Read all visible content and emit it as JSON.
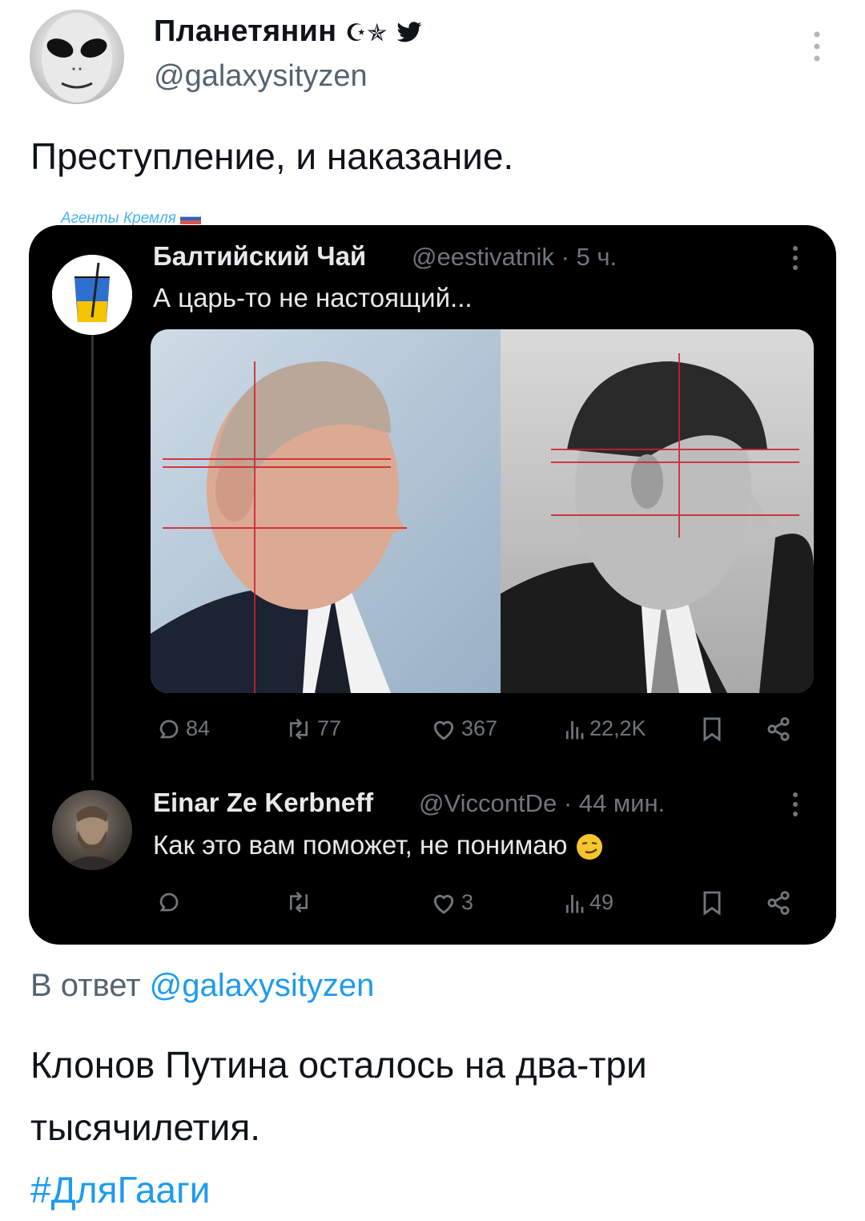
{
  "tweet": {
    "author": {
      "display_name": "Планетянин",
      "name_emoji": "☪︎✯",
      "handle": "@galaxysityzen"
    },
    "text": "Преступление, и наказание."
  },
  "embedded_screenshot": {
    "watermark": "Агенты Кремля",
    "post1": {
      "name": "Балтийский Чай",
      "handle": "@eestivatnik",
      "time": "· 5 ч.",
      "text": "А царь-то не настоящий...",
      "actions": {
        "reply_count": "84",
        "retweet_count": "77",
        "like_count": "367",
        "views_count": "22,2K"
      }
    },
    "post2": {
      "name": "Einar Ze Kerbneff",
      "handle": "@ViccontDe",
      "time": "· 44 мин.",
      "text": "Как это вам поможет, не понимаю",
      "actions": {
        "reply_count": "",
        "retweet_count": "",
        "like_count": "3",
        "views_count": "49"
      }
    }
  },
  "reply": {
    "prefix": "В ответ",
    "handle": "@galaxysityzen",
    "text": "Клонов Путина осталось на два-три тысячилетия.",
    "hashtag": "#ДляГааги"
  },
  "colors": {
    "link": "#1d9bf0",
    "secondary": "#536471",
    "embed_bg": "#000000"
  }
}
